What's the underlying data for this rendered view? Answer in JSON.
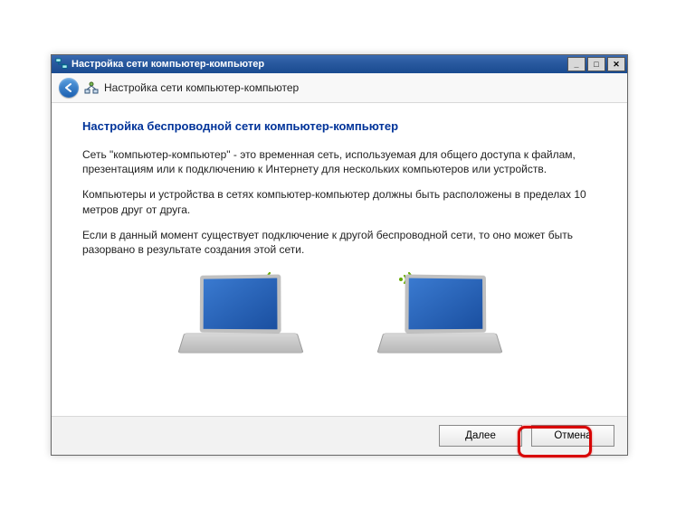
{
  "titlebar": {
    "title": "Настройка сети компьютер-компьютер"
  },
  "subheader": {
    "subtitle": "Настройка сети компьютер-компьютер"
  },
  "content": {
    "heading": "Настройка беспроводной сети компьютер-компьютер",
    "p1": "Сеть \"компьютер-компьютер\" - это временная сеть, используемая для общего доступа к файлам, презентациям или к подключению к Интернету для нескольких компьютеров или устройств.",
    "p2": "Компьютеры и устройства в сетях компьютер-компьютер должны быть расположены в пределах 10 метров друг от друга.",
    "p3": "Если в данный момент существует подключение к другой беспроводной сети, то оно может быть разорвано в результате создания этой сети."
  },
  "footer": {
    "next": "Далее",
    "cancel": "Отмена"
  }
}
